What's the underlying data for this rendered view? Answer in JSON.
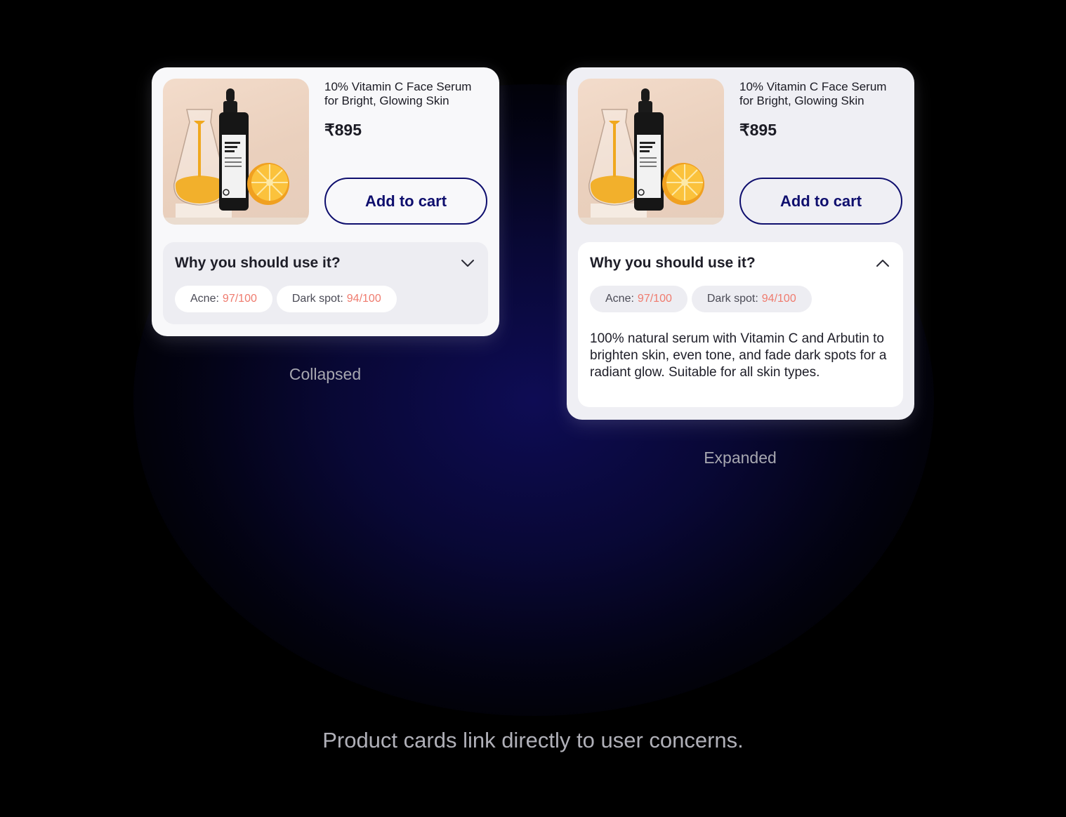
{
  "product": {
    "title": "10% Vitamin C Face Serum for Bright, Glowing Skin",
    "price": "₹895",
    "add_to_cart_label": "Add to cart",
    "image_icon": "serum-bottle-product-image"
  },
  "section": {
    "title": "Why you should use it?",
    "chips": [
      {
        "label": "Acne:",
        "value": "97/100"
      },
      {
        "label": "Dark spot:",
        "value": "94/100"
      }
    ],
    "description": "100% natural serum with Vitamin C and Arbutin to brighten skin, even tone, and fade dark spots for a radiant glow. Suitable for all skin types."
  },
  "captions": {
    "collapsed": "Collapsed",
    "expanded": "Expanded"
  },
  "footer": "Product cards link directly to user concerns.",
  "colors": {
    "background": "#000000",
    "glow": "#0e0c54",
    "accent": "#0f0f6e",
    "score": "#ef7b6e",
    "caption": "#a7a7b0"
  }
}
